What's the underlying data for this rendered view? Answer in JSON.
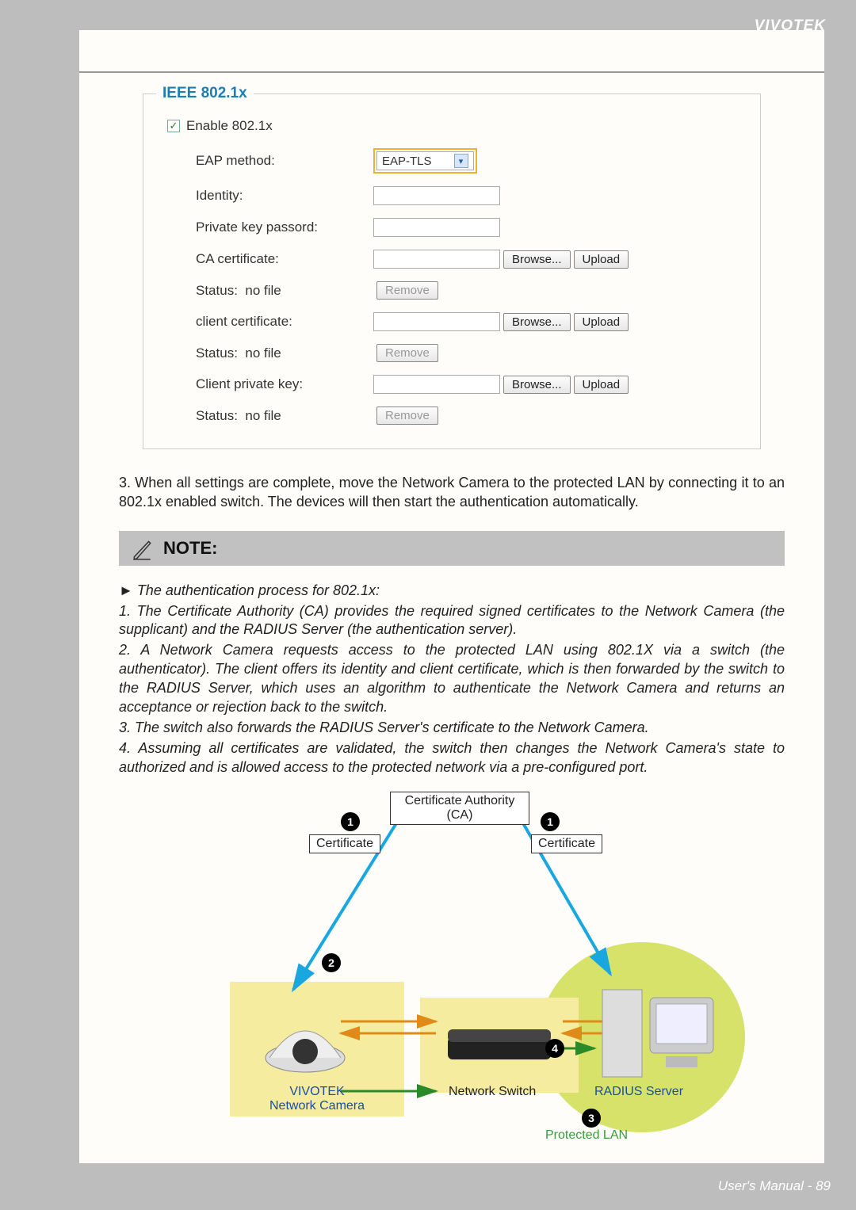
{
  "brand": "VIVOTEK",
  "footer": {
    "label": "User's Manual - ",
    "page": "89"
  },
  "panel": {
    "legend": "IEEE 802.1x",
    "enable_label": "Enable 802.1x",
    "enable_checked": "✓",
    "eap_label": "EAP method:",
    "eap_value": "EAP-TLS",
    "identity_label": "Identity:",
    "pkpass_label": "Private key passord:",
    "ca_label": "CA certificate:",
    "client_cert_label": "client certificate:",
    "client_key_label": "Client private key:",
    "status_label": "Status:",
    "status_value": "no file",
    "browse": "Browse...",
    "upload": "Upload",
    "remove": "Remove"
  },
  "step3": "3. When all settings are complete, move the Network Camera to the protected LAN by connecting it to an 802.1x enabled switch. The devices will then start the authentication automatically.",
  "note": {
    "title": "NOTE:",
    "intro": "► The authentication process for 802.1x:",
    "items": [
      "1. The Certificate Authority (CA) provides the required signed certificates to the Network Camera (the supplicant) and the RADIUS Server (the authentication server).",
      "2. A Network Camera requests access to the protected LAN using 802.1X via a switch (the authenticator). The client offers its identity and client certificate, which is then forwarded by the switch to the RADIUS Server, which uses an algorithm to authenticate the Network Camera and returns an acceptance or rejection back to the switch.",
      "3. The switch also forwards the RADIUS Server's certificate to the Network Camera.",
      "4. Assuming all certificates are validated, the switch then changes the Network Camera's state to authorized and is allowed access to the protected network via a pre-configured port."
    ]
  },
  "diagram": {
    "ca_line1": "Certificate Authority",
    "ca_line2": "(CA)",
    "certificate": "Certificate",
    "camera_line1": "VIVOTEK",
    "camera_line2": "Network Camera",
    "switch": "Network Switch",
    "radius": "RADIUS Server",
    "protected_lan": "Protected LAN",
    "n1": "1",
    "n2": "2",
    "n3": "3",
    "n4": "4"
  }
}
